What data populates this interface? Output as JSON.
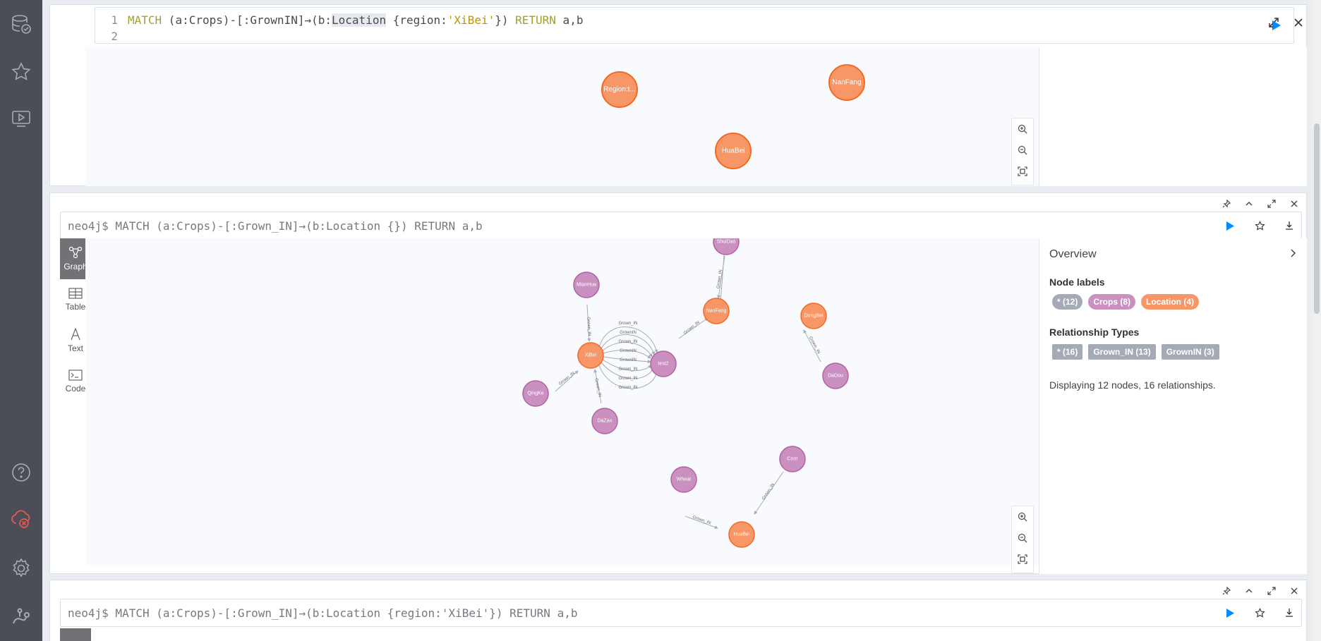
{
  "editor": {
    "line_numbers": [
      "1",
      "2"
    ],
    "query": {
      "kw_match": "MATCH",
      "part1": " (a:Crops)-[:GrownIN]",
      "arrow": "→",
      "part2": "(b:",
      "hl": "Location",
      "part3": " {region:",
      "region_value": "'XiBei'",
      "part4": "}) ",
      "kw_return": "RETURN",
      "part5": " a,b"
    }
  },
  "frame1": {
    "nodes": [
      {
        "label": "Region:t...",
        "color": "#f79767"
      },
      {
        "label": "NanFang",
        "color": "#f79767"
      },
      {
        "label": "HuaBei",
        "color": "#f79767"
      }
    ]
  },
  "frame2": {
    "command": "neo4j$ MATCH (a:Crops)-[:Grown_IN]→(b:Location {}) RETURN a,b",
    "tabs": [
      "Graph",
      "Table",
      "Text",
      "Code"
    ],
    "overview": {
      "title": "Overview",
      "node_labels_heading": "Node labels",
      "node_labels": [
        "* (12)",
        "Crops (8)",
        "Location (4)"
      ],
      "relationship_types_heading": "Relationship Types",
      "relationship_types": [
        "* (16)",
        "Grown_IN (13)",
        "GrownIN (3)"
      ],
      "summary": "Displaying 12 nodes, 16 relationships."
    },
    "nodes": {
      "ShuiDao": "ShuiDao",
      "MianHua": "MianHua",
      "NanFang": "NanFang",
      "DongBei": "DongBei",
      "XiBei": "XiBei",
      "test2": "test2",
      "DaDou": "DaDou",
      "QingKe": "QingKe",
      "DaZao": "DaZao",
      "Corn": "Corn",
      "Wheat": "Wheat",
      "HuaBei": "HuaBei"
    },
    "rel_labels": [
      "Grown_IN",
      "GrownIN",
      "Grown_IN",
      "GrownIN",
      "GrownIN",
      "Grown_IN",
      "Grown_IN",
      "Grown_IN"
    ],
    "rel_short": "Grown_IN",
    "colors": {
      "crops": "#c990c0",
      "location": "#f79767"
    }
  },
  "frame3": {
    "command": "neo4j$ MATCH (a:Crops)-[:Grown_IN]→(b:Location {region:'XiBei'}) RETURN a,b"
  }
}
